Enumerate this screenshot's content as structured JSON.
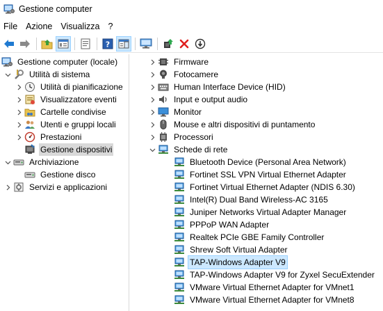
{
  "window": {
    "title": "Gestione computer"
  },
  "menu": [
    "File",
    "Azione",
    "Visualizza",
    "?"
  ],
  "toolbar": {
    "icons": [
      "back-arrow-icon",
      "forward-arrow-icon",
      "up-folder-icon",
      "show-hide-tree-icon",
      "properties-icon",
      "help-icon",
      "help-pane-icon",
      "monitor-scan-icon",
      "update-driver-icon",
      "uninstall-icon",
      "disable-icon"
    ]
  },
  "tree": {
    "root": "Gestione computer (locale)",
    "system_tools": "Utilità di sistema",
    "task_scheduler": "Utilità di pianificazione",
    "event_viewer": "Visualizzatore eventi",
    "shared_folders": "Cartelle condivise",
    "local_users": "Utenti e gruppi locali",
    "performance": "Prestazioni",
    "device_manager": "Gestione dispositivi",
    "storage": "Archiviazione",
    "disk_management": "Gestione disco",
    "services_apps": "Servizi e applicazioni"
  },
  "devices": {
    "categories": [
      "Firmware",
      "Fotocamere",
      "Human Interface Device (HID)",
      "Input e output audio",
      "Monitor",
      "Mouse e altri dispositivi di puntamento",
      "Processori"
    ],
    "network_category": "Schede di rete",
    "network_adapters": [
      "Bluetooth Device (Personal Area Network)",
      "Fortinet SSL VPN Virtual Ethernet Adapter",
      "Fortinet Virtual Ethernet Adapter (NDIS 6.30)",
      "Intel(R) Dual Band Wireless-AC 3165",
      "Juniper Networks Virtual Adapter Manager",
      "PPPoP WAN Adapter",
      "Realtek PCIe GBE Family Controller",
      "Shrew Soft Virtual Adapter",
      "TAP-Windows Adapter V9",
      "TAP-Windows Adapter V9 for Zyxel SecuExtender",
      "VMware Virtual Ethernet Adapter for VMnet1",
      "VMware Virtual Ethernet Adapter for VMnet8"
    ],
    "highlighted_adapter": "TAP-Windows Adapter V9"
  }
}
